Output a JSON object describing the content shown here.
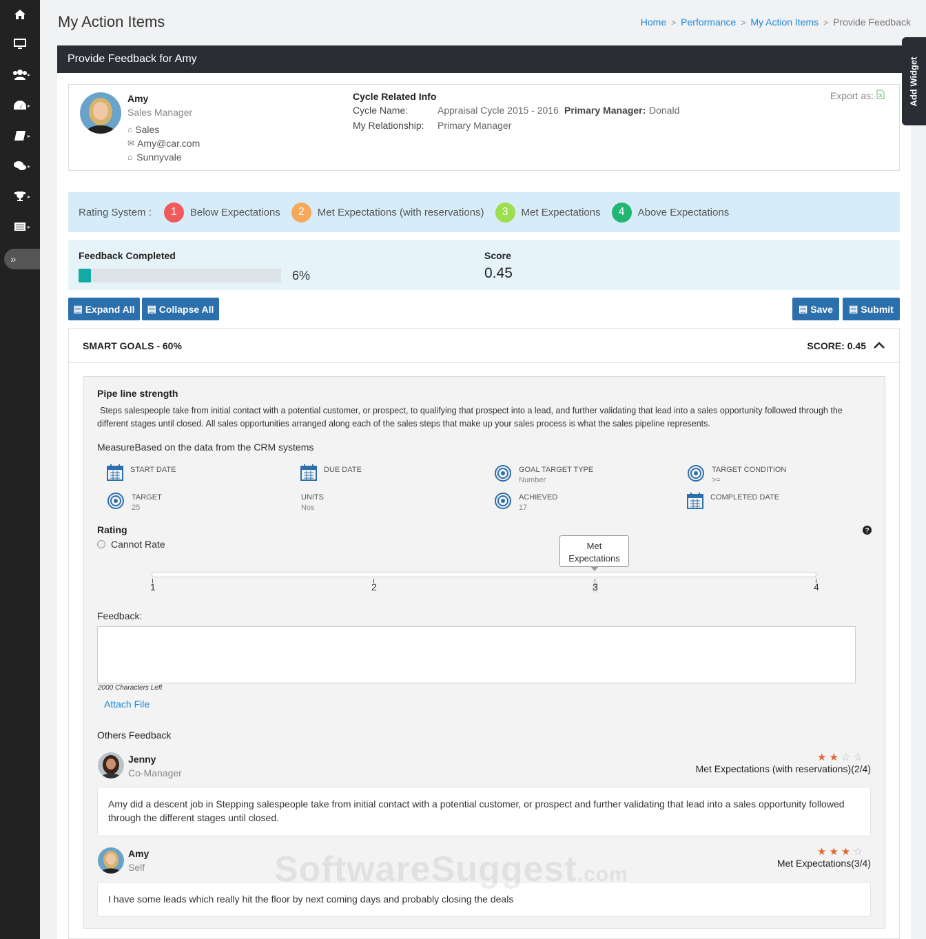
{
  "page": {
    "title": "My Action Items"
  },
  "breadcrumb": [
    {
      "label": "Home"
    },
    {
      "label": "Performance"
    },
    {
      "label": "My Action Items"
    },
    {
      "label": "Provide Feedback"
    }
  ],
  "panel": {
    "title": "Provide Feedback for Amy",
    "add_widget": "Add Widget"
  },
  "employee": {
    "name": "Amy",
    "role": "Sales Manager",
    "department": "Sales",
    "email": "Amy@car.com",
    "location": "Sunnyvale"
  },
  "cycle": {
    "heading": "Cycle Related Info",
    "cycle_name_label": "Cycle Name:",
    "cycle_name": "Appraisal Cycle 2015 - 2016",
    "primary_manager_label": "Primary Manager:",
    "primary_manager": "Donald",
    "relationship_label": "My Relationship:",
    "relationship": "Primary Manager",
    "export_label": "Export as:"
  },
  "rating_system": {
    "label": "Rating System :",
    "levels": [
      {
        "num": "1",
        "label": "Below Expectations",
        "color": "#f05a5b"
      },
      {
        "num": "2",
        "label": "Met Expectations (with reservations)",
        "color": "#f7a95a"
      },
      {
        "num": "3",
        "label": "Met Expectations",
        "color": "#9cde4d"
      },
      {
        "num": "4",
        "label": "Above Expectations",
        "color": "#22b573"
      }
    ]
  },
  "progress": {
    "label": "Feedback Completed",
    "percent_text": "6%",
    "percent": 6,
    "score_label": "Score",
    "score": "0.45"
  },
  "buttons": {
    "expand": "Expand All",
    "collapse": "Collapse All",
    "save": "Save",
    "submit": "Submit"
  },
  "goals": {
    "title": "SMART GOALS - 60%",
    "score": "SCORE: 0.45"
  },
  "goal": {
    "name": "Pipe line strength",
    "description": "Steps salespeople take from initial contact with a potential customer, or prospect, to qualifying that prospect into a lead, and further validating that lead into a sales opportunity followed through the different stages until closed.  All sales opportunities arranged along each of the sales steps that make up your sales process is what the sales pipeline represents.",
    "measure": "MeasureBased on the data from the CRM systems",
    "fields": {
      "start_date": {
        "label": "START DATE",
        "value": ""
      },
      "due_date": {
        "label": "DUE DATE",
        "value": ""
      },
      "goal_target_type": {
        "label": "GOAL TARGET TYPE",
        "value": "Number"
      },
      "target_condition": {
        "label": "TARGET CONDITION",
        "value": ">="
      },
      "target": {
        "label": "TARGET",
        "value": "25"
      },
      "units": {
        "label": "UNITS",
        "value": "Nos"
      },
      "achieved": {
        "label": "ACHIEVED",
        "value": "17"
      },
      "completed_date": {
        "label": "COMPLETED DATE",
        "value": ""
      }
    },
    "rating_label": "Rating",
    "cannot_rate": "Cannot Rate",
    "slider": {
      "ticks": [
        "1",
        "2",
        "3",
        "4"
      ],
      "value": 3,
      "tooltip_line1": "Met",
      "tooltip_line2": "Expectations"
    },
    "feedback_label": "Feedback:",
    "chars_left": "2000 Characters Left",
    "attach": "Attach File",
    "others_label": "Others Feedback"
  },
  "others": [
    {
      "name": "Jenny",
      "role": "Co-Manager",
      "rating_text": "Met Expectations (with reservations)(2/4)",
      "stars": 2,
      "max": 4,
      "comment": "Amy did a descent job in Stepping salespeople take from initial contact with a potential customer, or prospect and further validating that lead into a sales opportunity followed through the different stages until closed."
    },
    {
      "name": "Amy",
      "role": "Self",
      "rating_text": "Met Expectations(3/4)",
      "stars": 3,
      "max": 4,
      "comment": "I have some leads which really hit the floor by next coming days and probably closing the deals"
    }
  ],
  "watermark": {
    "main": "SoftwareSuggest",
    "suffix": ".com"
  }
}
